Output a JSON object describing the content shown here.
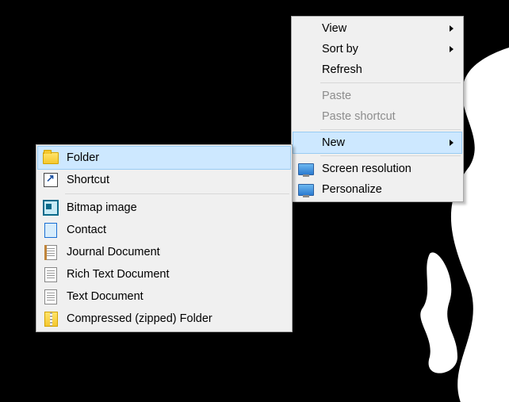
{
  "context_menu": {
    "items": [
      {
        "label": "View",
        "submenu": true,
        "disabled": false
      },
      {
        "label": "Sort by",
        "submenu": true,
        "disabled": false
      },
      {
        "label": "Refresh",
        "submenu": false,
        "disabled": false
      },
      {
        "separator": true
      },
      {
        "label": "Paste",
        "submenu": false,
        "disabled": true
      },
      {
        "label": "Paste shortcut",
        "submenu": false,
        "disabled": true
      },
      {
        "separator": true
      },
      {
        "label": "New",
        "submenu": true,
        "disabled": false,
        "hovered": true
      },
      {
        "separator": true
      },
      {
        "label": "Screen resolution",
        "submenu": false,
        "disabled": false,
        "icon": "monitor"
      },
      {
        "label": "Personalize",
        "submenu": false,
        "disabled": false,
        "icon": "monitor"
      }
    ]
  },
  "new_submenu": {
    "items": [
      {
        "label": "Folder",
        "icon": "folder",
        "hovered": true
      },
      {
        "label": "Shortcut",
        "icon": "shortcut"
      },
      {
        "separator": true
      },
      {
        "label": "Bitmap image",
        "icon": "bitmap"
      },
      {
        "label": "Contact",
        "icon": "contact"
      },
      {
        "label": "Journal Document",
        "icon": "journal"
      },
      {
        "label": "Rich Text Document",
        "icon": "doc"
      },
      {
        "label": "Text Document",
        "icon": "doc"
      },
      {
        "label": "Compressed (zipped) Folder",
        "icon": "zip"
      }
    ]
  }
}
